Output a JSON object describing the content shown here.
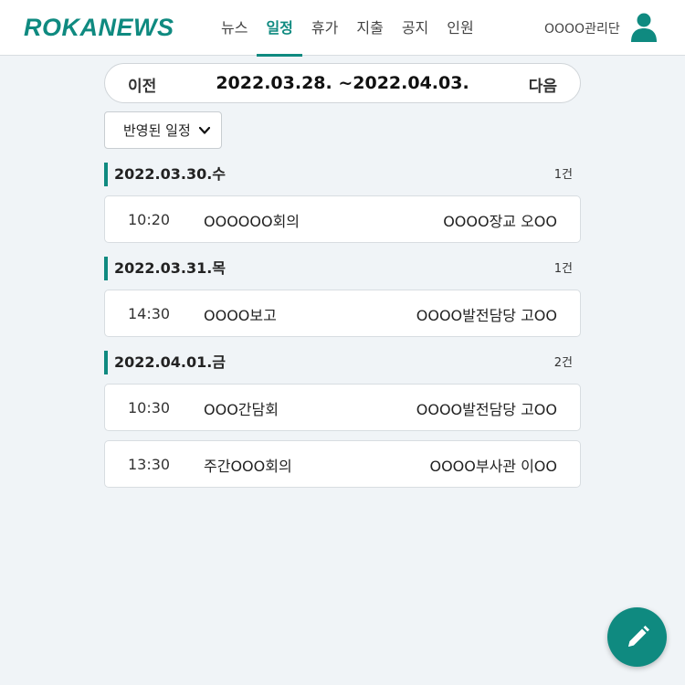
{
  "brand": {
    "logo": "ROKANEWS",
    "accent_color": "#0f8a80"
  },
  "nav": {
    "items": [
      {
        "label": "뉴스",
        "active": false
      },
      {
        "label": "일정",
        "active": true
      },
      {
        "label": "휴가",
        "active": false
      },
      {
        "label": "지출",
        "active": false
      },
      {
        "label": "공지",
        "active": false
      },
      {
        "label": "인원",
        "active": false
      }
    ]
  },
  "user": {
    "org_name": "OOOO관리단",
    "icon": "user-icon"
  },
  "week": {
    "prev_label": "이전",
    "range": "2022.03.28. ~2022.04.03.",
    "next_label": "다음"
  },
  "filter": {
    "selected": "반영된 일정",
    "icon": "chevron-down-icon"
  },
  "days": [
    {
      "date": "2022.03.30.수",
      "count": "1건",
      "events": [
        {
          "time": "10:20",
          "title": "OOOOOO회의",
          "person": "OOOO장교 오OO"
        }
      ]
    },
    {
      "date": "2022.03.31.목",
      "count": "1건",
      "events": [
        {
          "time": "14:30",
          "title": "OOOO보고",
          "person": "OOOO발전담당 고OO"
        }
      ]
    },
    {
      "date": "2022.04.01.금",
      "count": "2건",
      "events": [
        {
          "time": "10:30",
          "title": "OOO간담회",
          "person": "OOOO발전담당 고OO"
        },
        {
          "time": "13:30",
          "title": "주간OOO회의",
          "person": "OOOO부사관 이OO"
        }
      ]
    }
  ],
  "fab": {
    "icon": "pencil-icon"
  }
}
